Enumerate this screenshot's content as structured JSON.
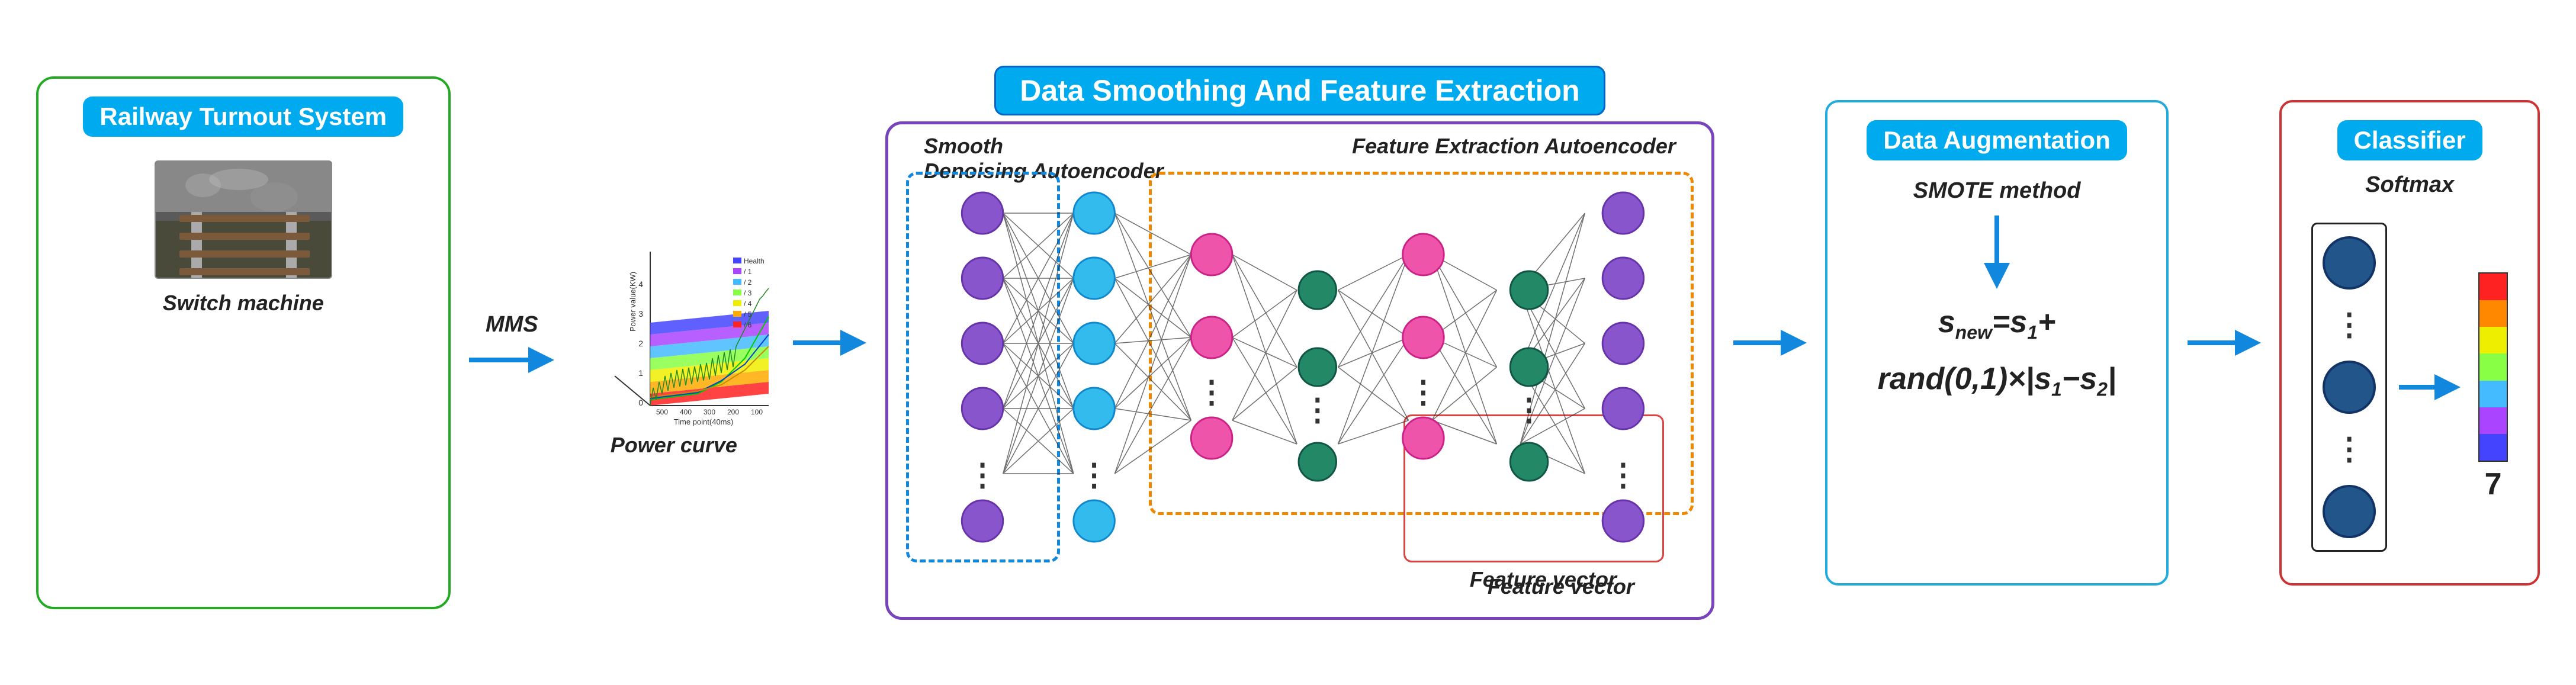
{
  "railway": {
    "title": "Railway Turnout System",
    "mms_label": "MMS",
    "switch_caption": "Switch machine",
    "power_caption": "Power curve"
  },
  "data_smoothing": {
    "title": "Data Smoothing And Feature Extraction",
    "smooth_label": "Smooth",
    "denoising_label": "Denoising Autoencoder",
    "feature_extraction_label": "Feature Extraction Autoencoder",
    "feature_vector_label": "Feature vector"
  },
  "augmentation": {
    "title": "Data Augmentation",
    "smote_label": "SMOTE method",
    "formula_line1": "s_new=s_1+",
    "formula_line2": "rand(0,1)×|s₁−s₂|"
  },
  "classifier": {
    "title": "Classifier",
    "softmax_label": "Softmax",
    "number": "7"
  },
  "arrows": {
    "color": "#1188dd"
  }
}
